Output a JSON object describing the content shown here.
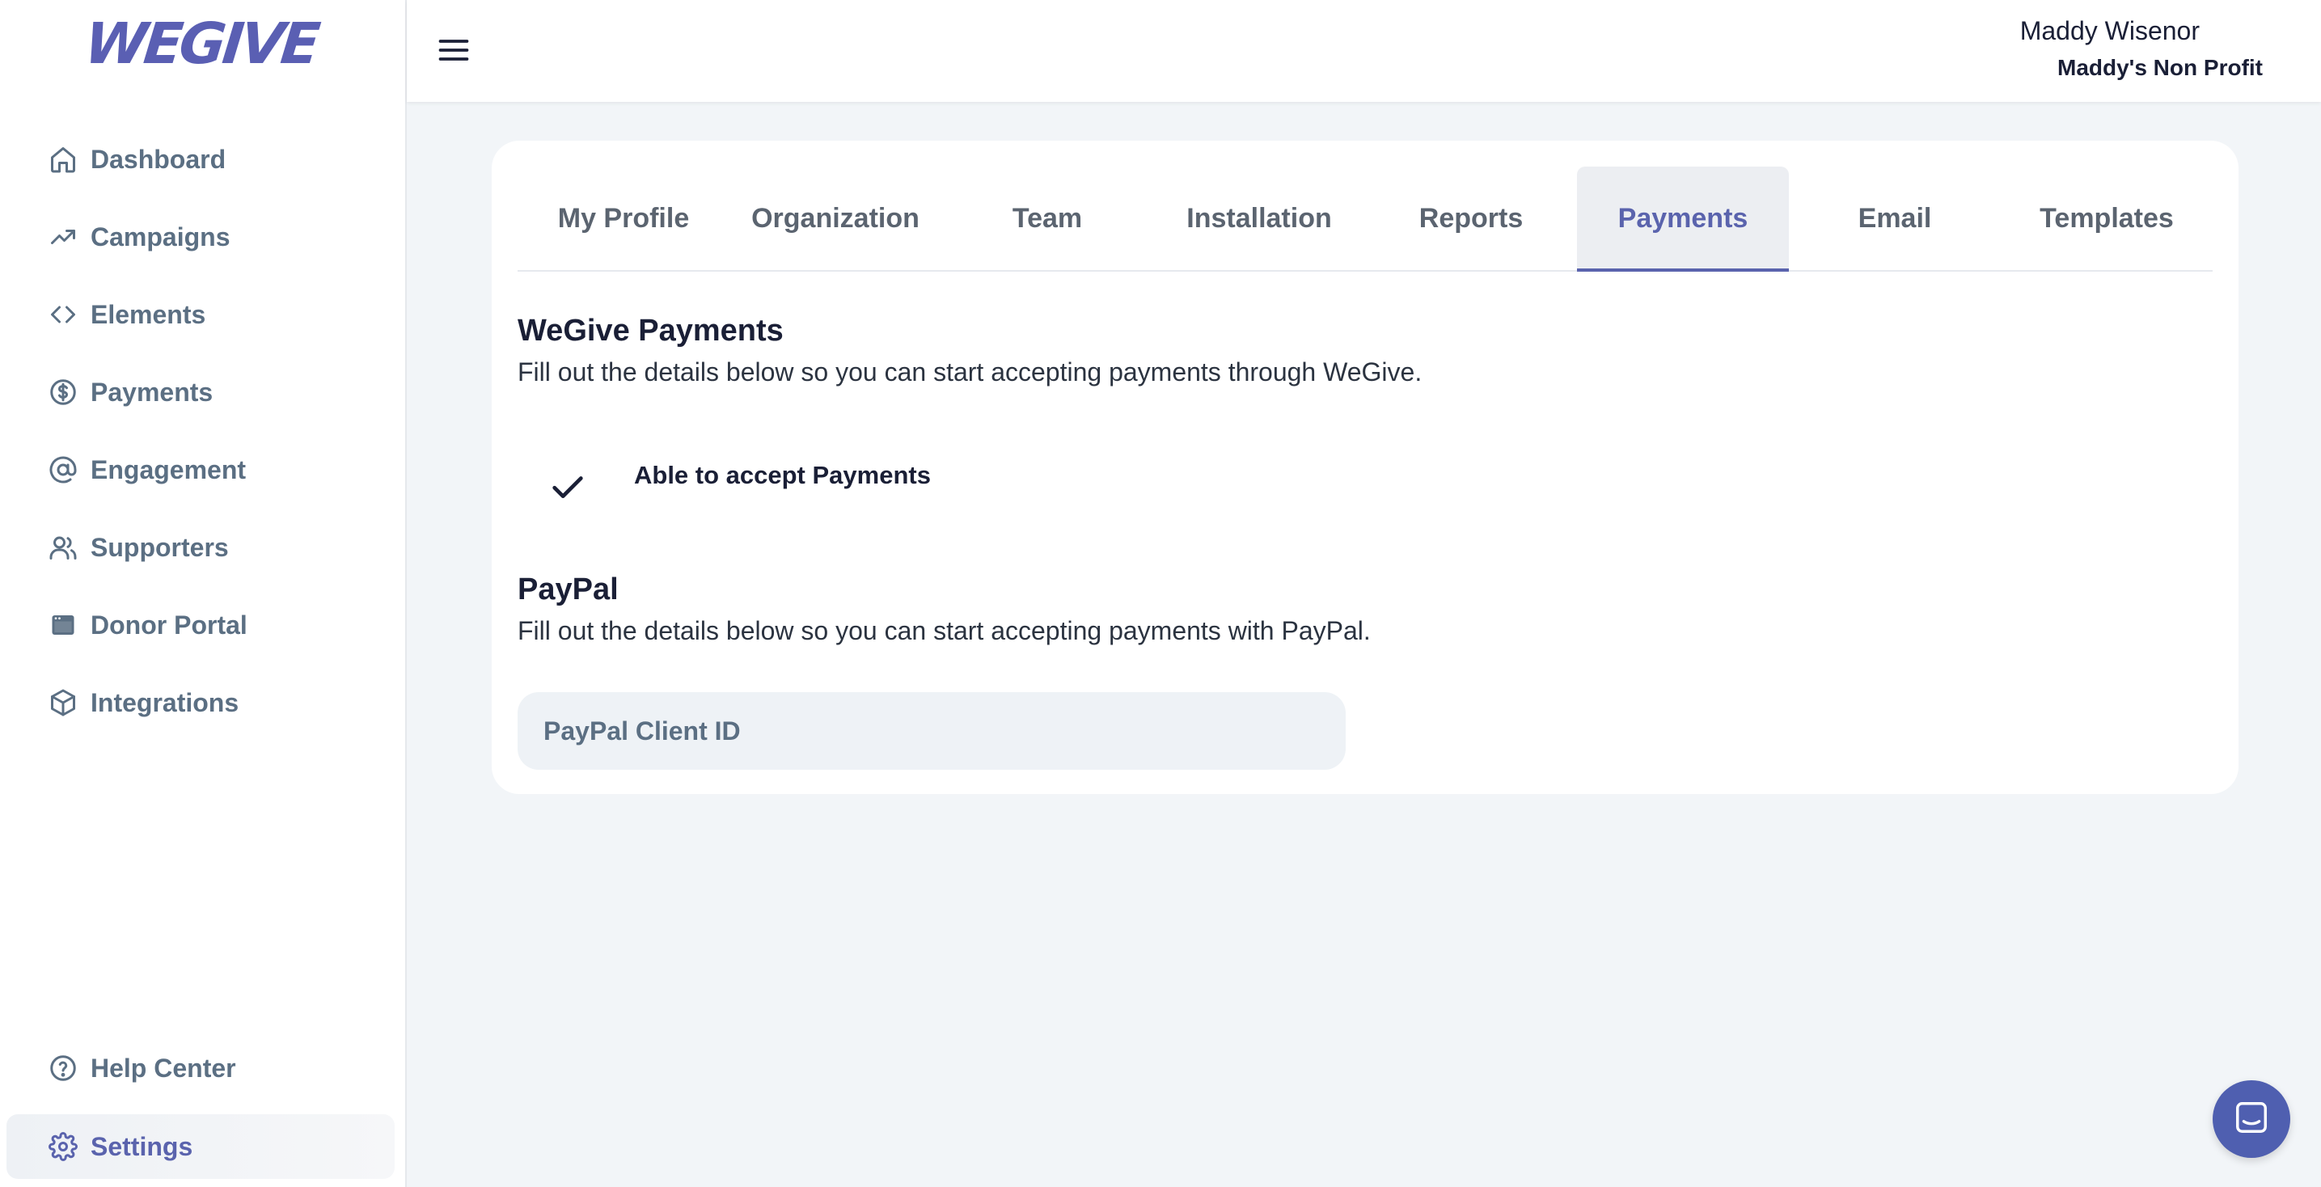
{
  "brand": {
    "logo_text": "WEGIVE",
    "accent": "#5a63ad"
  },
  "sidebar": {
    "items": [
      {
        "label": "Dashboard",
        "icon": "home-icon"
      },
      {
        "label": "Campaigns",
        "icon": "trend-icon"
      },
      {
        "label": "Elements",
        "icon": "code-icon"
      },
      {
        "label": "Payments",
        "icon": "dollar-circle-icon"
      },
      {
        "label": "Engagement",
        "icon": "at-icon"
      },
      {
        "label": "Supporters",
        "icon": "users-icon"
      },
      {
        "label": "Donor Portal",
        "icon": "window-icon"
      },
      {
        "label": "Integrations",
        "icon": "cube-icon"
      }
    ],
    "bottom_items": [
      {
        "label": "Help Center",
        "icon": "help-circle-icon"
      },
      {
        "label": "Settings",
        "icon": "gear-icon",
        "active": true
      }
    ]
  },
  "header": {
    "user_name": "Maddy Wisenor",
    "org_name": "Maddy's Non Profit"
  },
  "settings": {
    "tabs": [
      "My Profile",
      "Organization",
      "Team",
      "Installation",
      "Reports",
      "Payments",
      "Email",
      "Templates"
    ],
    "active_tab": "Payments",
    "wegive": {
      "title": "WeGive Payments",
      "description": "Fill out the details below so you can start accepting payments through WeGive.",
      "status": "Able to accept Payments"
    },
    "paypal": {
      "title": "PayPal",
      "description": "Fill out the details below so you can start accepting payments with PayPal.",
      "client_id_placeholder": "PayPal Client ID",
      "client_id_value": ""
    }
  }
}
